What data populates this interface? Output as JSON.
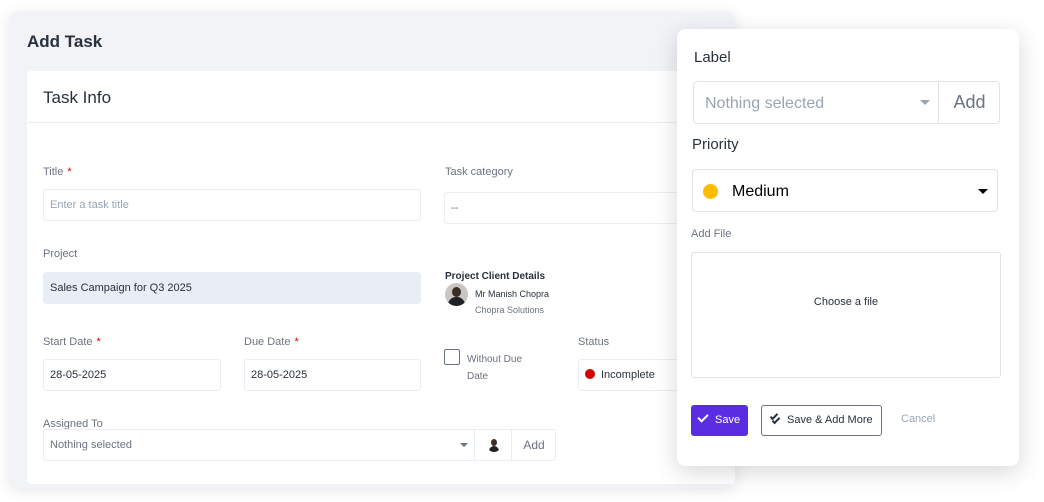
{
  "page": {
    "title": "Add Task"
  },
  "task_info": {
    "heading": "Task Info",
    "title_label": "Title",
    "title_placeholder": "Enter a task title",
    "category_label": "Task category",
    "category_value": "--",
    "project_label": "Project",
    "project_value": "Sales Campaign for Q3 2025",
    "client": {
      "heading": "Project Client Details",
      "name": "Mr Manish Chopra",
      "company": "Chopra Solutions"
    },
    "start_date_label": "Start Date",
    "start_date_value": "28-05-2025",
    "due_date_label": "Due Date",
    "due_date_value": "28-05-2025",
    "without_due_date_label": "Without Due Date",
    "without_due_date_checked": false,
    "status_label": "Status",
    "status_value": "Incomplete",
    "status_color": "#d30000",
    "assigned_label": "Assigned To",
    "assigned_value": "Nothing selected",
    "assigned_add": "Add",
    "required_mark": "*"
  },
  "panel": {
    "label_heading": "Label",
    "label_value": "Nothing selected",
    "label_add": "Add",
    "priority_heading": "Priority",
    "priority_value": "Medium",
    "priority_color": "#fcbd01",
    "file_heading": "Add File",
    "file_prompt": "Choose a file",
    "save": "Save",
    "save_more": "Save & Add More",
    "cancel": "Cancel",
    "accent_color": "#5a2de3"
  }
}
